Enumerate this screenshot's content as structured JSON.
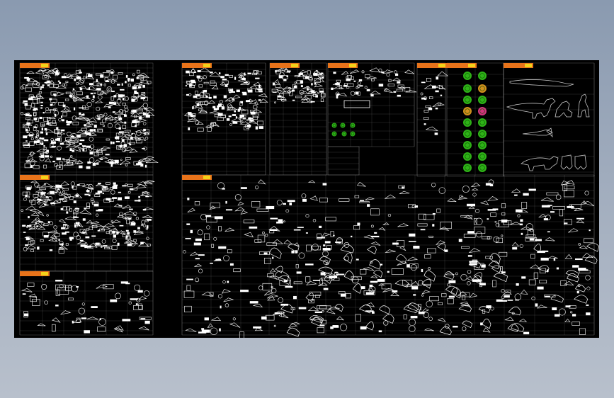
{
  "canvas": {
    "background": "#000000",
    "line_color": "#c8c8c8",
    "symbol_color": "#ffffff",
    "plant_color": "#33c61a",
    "header_tag_color": "#e8731a",
    "header_tag_accent": "#f2d21a"
  },
  "sections": [
    {
      "id": "furniture-blocks"
    },
    {
      "id": "elevation-blocks"
    },
    {
      "id": "detail-blocks"
    },
    {
      "id": "fixtures-blocks"
    },
    {
      "id": "equipment-blocks"
    },
    {
      "id": "plant-blocks"
    },
    {
      "id": "dinosaur-blocks"
    },
    {
      "id": "lighting-blocks"
    },
    {
      "id": "vehicle-blocks"
    },
    {
      "id": "misc-blocks"
    },
    {
      "id": "rockery-blocks"
    }
  ]
}
